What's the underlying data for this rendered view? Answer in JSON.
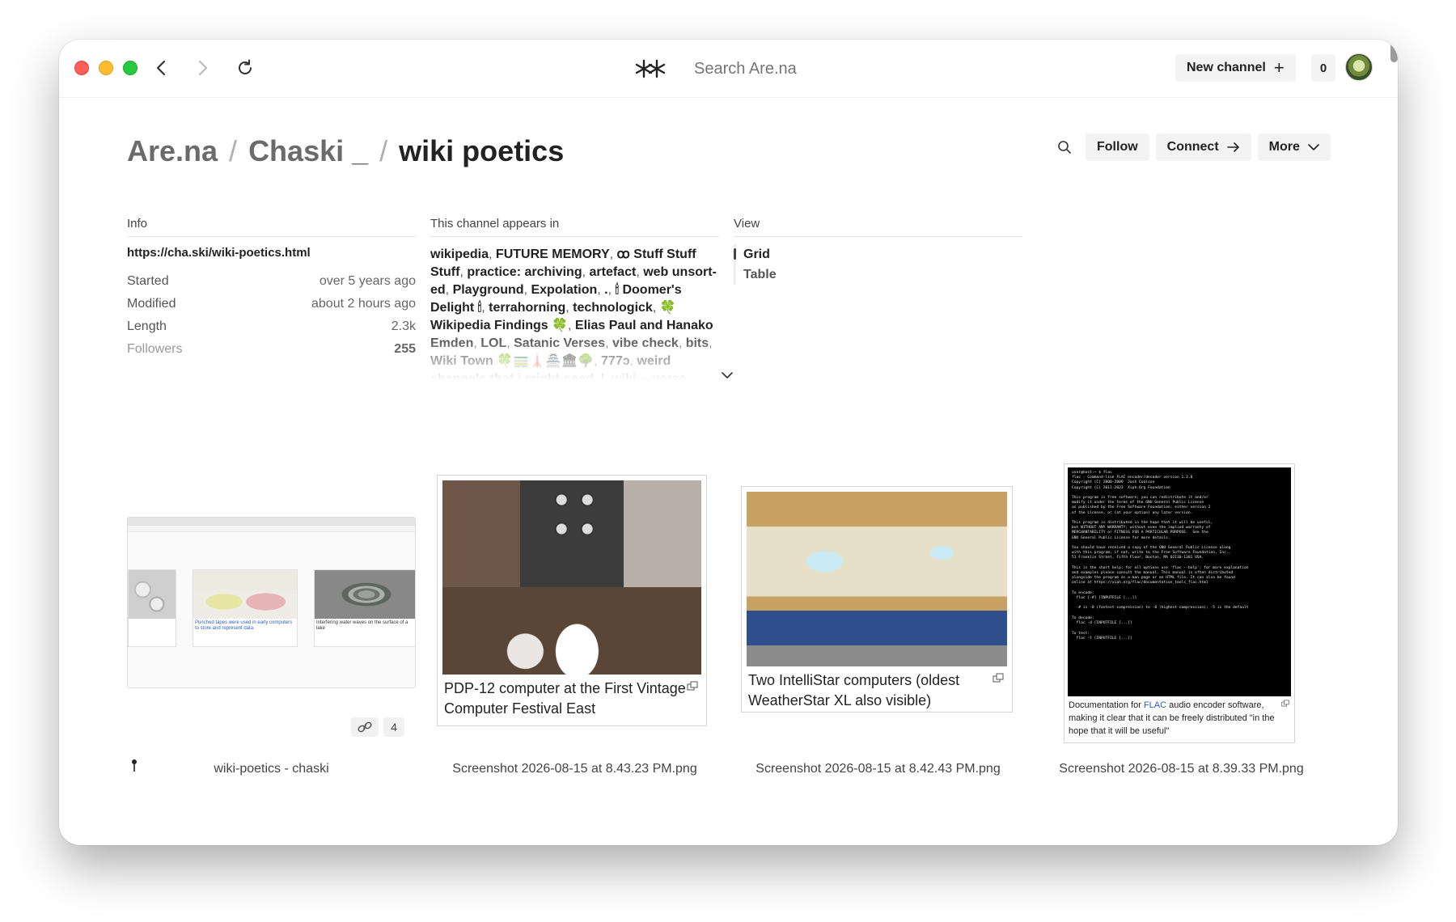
{
  "search": {
    "placeholder": "Search Are.na"
  },
  "toolbar": {
    "new_channel_label": "New channel",
    "notification_count": "0"
  },
  "breadcrumb": {
    "root": "Are.na",
    "user": "Chaski _",
    "channel": "wiki poetics"
  },
  "actions": {
    "follow": "Follow",
    "connect": "Connect",
    "more": "More"
  },
  "info": {
    "title": "Info",
    "url": "https://cha.ski/wiki-poetics.html",
    "rows": [
      {
        "label": "Started",
        "value": "over 5 years ago"
      },
      {
        "label": "Modified",
        "value": "about 2 hours ago"
      },
      {
        "label": "Length",
        "value": "2.3k"
      },
      {
        "label": "Followers",
        "value": "255"
      }
    ]
  },
  "appears_in": {
    "title": "This channel appears in",
    "channels": [
      "wikipedia",
      "FUTURE MEMORY",
      "ꝏ Stuff Stuff Stuff",
      "practice: archiving",
      "artefact",
      "web unsort-ed",
      "Playground",
      "Expolation",
      ".",
      "🕯 Doomer's Delight 🕯",
      "terrahorning",
      "technologick",
      "🍀 Wikipedia Findings 🍀",
      "Elias Paul and Hanako Emden",
      "LOL",
      "Satanic Verses",
      "vibe check",
      "bits",
      "Wiki Town 🍀🚃🗼🏯🏛🌳",
      "777ↄ",
      "weird channels that i might need",
      "|",
      "wiki —verse"
    ]
  },
  "view": {
    "title": "View",
    "options": [
      "Grid",
      "Table"
    ]
  },
  "blocks": [
    {
      "caption": "wiki-poetics - chaski",
      "link_count": "4",
      "mini_captions": [
        "Punched tapes were used in early computers to store and represent data.",
        "Interfering water waves on the surface of a lake"
      ]
    },
    {
      "caption": "Screenshot 2026-08-15 at 8.43.23 PM.png",
      "image_caption": "PDP-12 computer at the First Vintage Computer Festival East"
    },
    {
      "caption": "Screenshot 2026-08-15 at 8.42.43 PM.png",
      "image_caption": "Two IntelliStar computers (oldest WeatherStar XL also visible)"
    },
    {
      "caption": "Screenshot 2026-08-15 at 8.39.33 PM.png",
      "image_caption_pre": "Documentation for ",
      "image_caption_link": "FLAC",
      "image_caption_post": " audio encoder software, making it clear that it can be freely distributed \"in the hope that it will be useful\"",
      "terminal_text": "user@host:~ $ flac\nflac - Command-line FLAC encoder/decoder version 1.3.0\nCopyright (C) 2000-2009  Josh Coalson\nCopyright (C) 2011-2023  Xiph.Org Foundation\n\nThis program is free software; you can redistribute it and/or\nmodify it under the terms of the GNU General Public License\nas published by the Free Software Foundation; either version 2\nof the License, or (at your option) any later version.\n\nThis program is distributed in the hope that it will be useful,\nbut WITHOUT ANY WARRANTY; without even the implied warranty of\nMERCHANTABILITY or FITNESS FOR A PARTICULAR PURPOSE.  See the\nGNU General Public License for more details.\n\nYou should have received a copy of the GNU General Public License along\nwith this program; if not, write to the Free Software Foundation, Inc.,\n51 Franklin Street, Fifth Floor, Boston, MA 02110-1301 USA.\n\nThis is the short help; for all options use 'flac --help'; for more explanation\nand examples please consult the manual. This manual is often distributed\nalongside the program as a man page or an HTML file. It can also be found\nonline at https://xiph.org/flac/documentation_tools_flac.html\n\nTo encode:\n  flac [-#] [INPUTFILE [...]]\n\n  -# is -0 (fastest compression) to -8 (highest compression); -5 is the default\n\nTo decode:\n  flac -d [INPUTFILE [...]]\n\nTo test:\n  flac -t [INPUTFILE [...]]"
    }
  ],
  "colors": {
    "accent_link": "#2a5ec8",
    "button_bg": "#f3f3f3",
    "traffic_red": "#fe5f57",
    "traffic_yellow": "#febc2e",
    "traffic_green": "#28c840"
  }
}
